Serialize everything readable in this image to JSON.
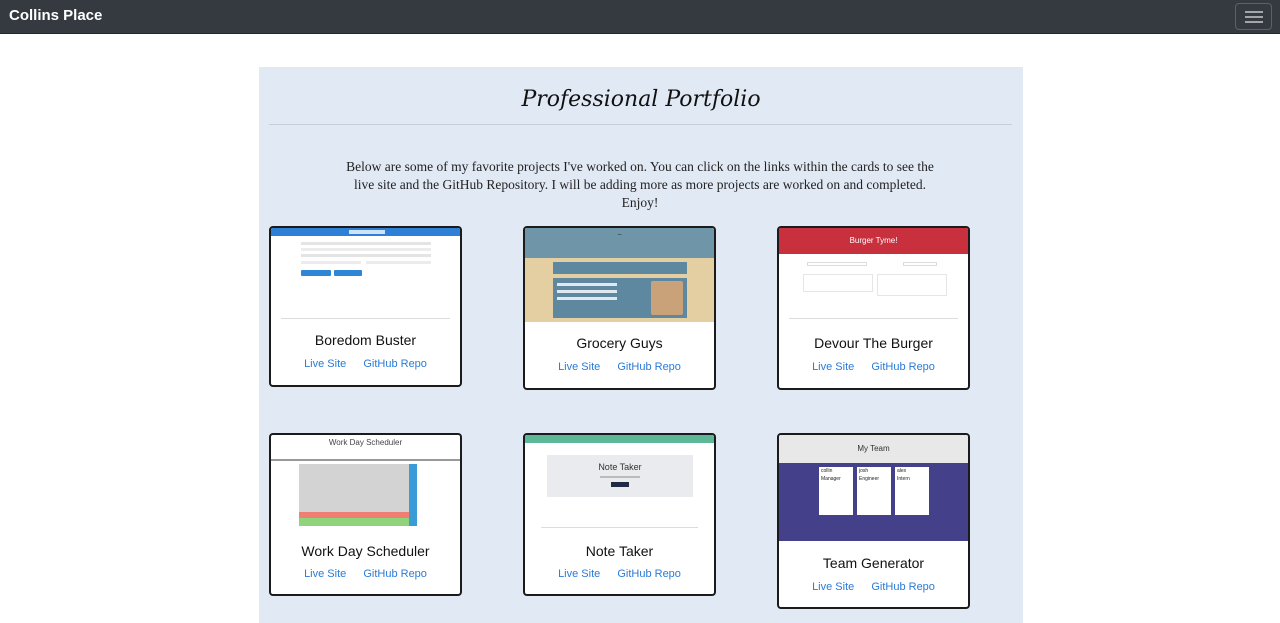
{
  "navbar": {
    "brand": "Collins Place",
    "menu_icon": "hamburger-icon"
  },
  "header": {
    "title": "Professional Portfolio",
    "intro": "Below are some of my favorite projects I've worked on. You can click on the links within the cards to see the live site and the GitHub Repository. I will be adding more as more projects are worked on and completed. Enjoy!"
  },
  "cards": [
    {
      "title": "Boredom Buster",
      "live_label": "Live Site",
      "repo_label": "GitHub Repo"
    },
    {
      "title": "Grocery Guys",
      "live_label": "Live Site",
      "repo_label": "GitHub Repo"
    },
    {
      "title": "Devour The Burger",
      "live_label": "Live Site",
      "repo_label": "GitHub Repo"
    },
    {
      "title": "Work Day Scheduler",
      "live_label": "Live Site",
      "repo_label": "GitHub Repo"
    },
    {
      "title": "Note Taker",
      "live_label": "Live Site",
      "repo_label": "GitHub Repo"
    },
    {
      "title": "Team Generator",
      "live_label": "Live Site",
      "repo_label": "GitHub Repo"
    }
  ],
  "thumbnails": {
    "burger": {
      "header": "Burger Tyme!"
    },
    "scheduler": {
      "header": "Work Day Scheduler"
    },
    "notes": {
      "header": "Note Taker"
    },
    "team": {
      "header": "My Team",
      "members": [
        "collin",
        "josh",
        "alex"
      ],
      "roles": [
        "Manager",
        "Engineer",
        "Intern"
      ]
    }
  },
  "colors": {
    "link": "#2a7bd6",
    "navbar": "#343a40",
    "jumbotron": "#e1e9f5",
    "burger_red": "#c9303e",
    "team_purple": "#45408a"
  }
}
